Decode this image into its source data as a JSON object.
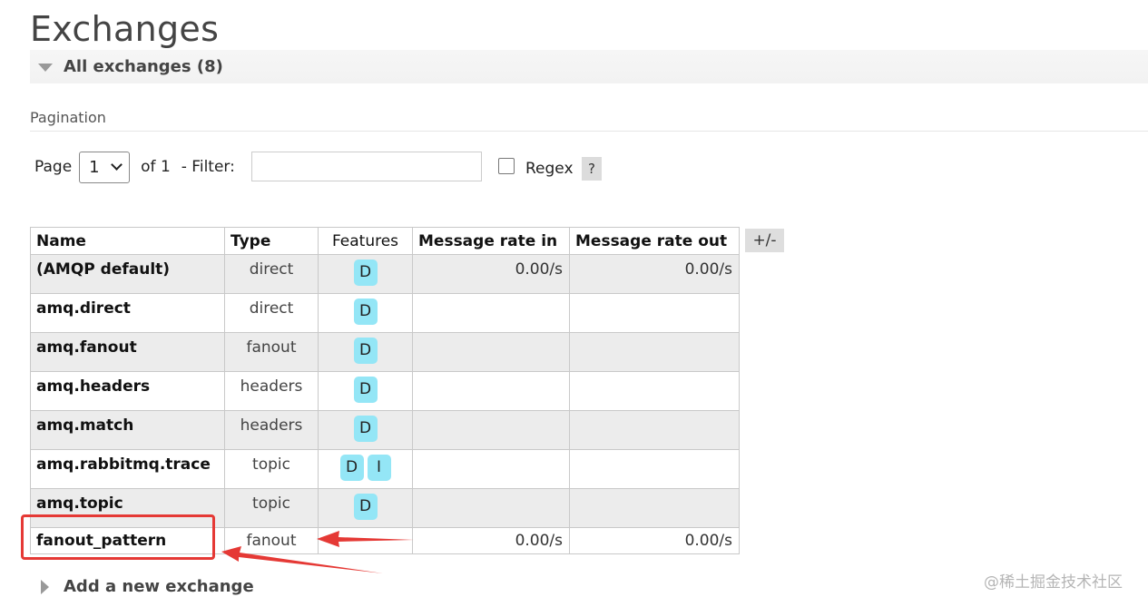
{
  "page_title": "Exchanges",
  "all_exchanges_label": "All exchanges (8)",
  "pagination": {
    "label": "Pagination",
    "page_label": "Page",
    "page_value": "1",
    "of_label": "of 1",
    "filter_label": "- Filter:",
    "filter_value": "",
    "regex_label": "Regex",
    "help_label": "?"
  },
  "table": {
    "columns": [
      "Name",
      "Type",
      "Features",
      "Message rate in",
      "Message rate out"
    ],
    "toggle_label": "+/-",
    "rows": [
      {
        "name": "(AMQP default)",
        "type": "direct",
        "features": [
          "D"
        ],
        "rate_in": "0.00/s",
        "rate_out": "0.00/s"
      },
      {
        "name": "amq.direct",
        "type": "direct",
        "features": [
          "D"
        ],
        "rate_in": "",
        "rate_out": ""
      },
      {
        "name": "amq.fanout",
        "type": "fanout",
        "features": [
          "D"
        ],
        "rate_in": "",
        "rate_out": ""
      },
      {
        "name": "amq.headers",
        "type": "headers",
        "features": [
          "D"
        ],
        "rate_in": "",
        "rate_out": ""
      },
      {
        "name": "amq.match",
        "type": "headers",
        "features": [
          "D"
        ],
        "rate_in": "",
        "rate_out": ""
      },
      {
        "name": "amq.rabbitmq.trace",
        "type": "topic",
        "features": [
          "D",
          "I"
        ],
        "rate_in": "",
        "rate_out": ""
      },
      {
        "name": "amq.topic",
        "type": "topic",
        "features": [
          "D"
        ],
        "rate_in": "",
        "rate_out": ""
      },
      {
        "name": "fanout_pattern",
        "type": "fanout",
        "features": [],
        "rate_in": "0.00/s",
        "rate_out": "0.00/s"
      }
    ]
  },
  "add_exchange_label": "Add a new exchange",
  "watermark": "@稀土掘金技术社区",
  "colors": {
    "annotation_red": "#e53935",
    "feature_badge": "#94e6f6",
    "row_stripe": "#ececec"
  },
  "icons": {
    "collapse": "triangle-down-icon",
    "expand": "triangle-right-icon",
    "select": "chevron-down-icon"
  }
}
